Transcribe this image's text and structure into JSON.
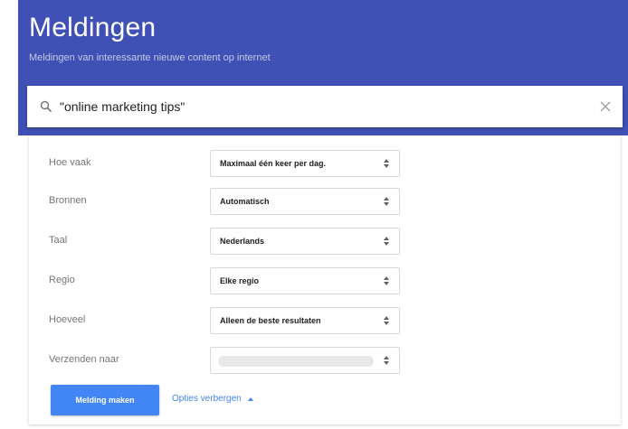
{
  "header": {
    "title": "Meldingen",
    "subtitle": "Meldingen van interessante nieuwe content op internet"
  },
  "search": {
    "query": "\"online marketing tips\""
  },
  "options": [
    {
      "label": "Hoe vaak",
      "value": "Maximaal één keer per dag."
    },
    {
      "label": "Bronnen",
      "value": "Automatisch"
    },
    {
      "label": "Taal",
      "value": "Nederlands"
    },
    {
      "label": "Regio",
      "value": "Elke regio"
    },
    {
      "label": "Hoeveel",
      "value": "Alleen de beste resultaten"
    },
    {
      "label": "Verzenden naar",
      "value": ""
    }
  ],
  "actions": {
    "create_label": "Melding maken",
    "hide_options_label": "Opties verbergen"
  },
  "colors": {
    "header_bg": "#3f51b5",
    "primary_button": "#4285f4",
    "link": "#4285f4"
  }
}
